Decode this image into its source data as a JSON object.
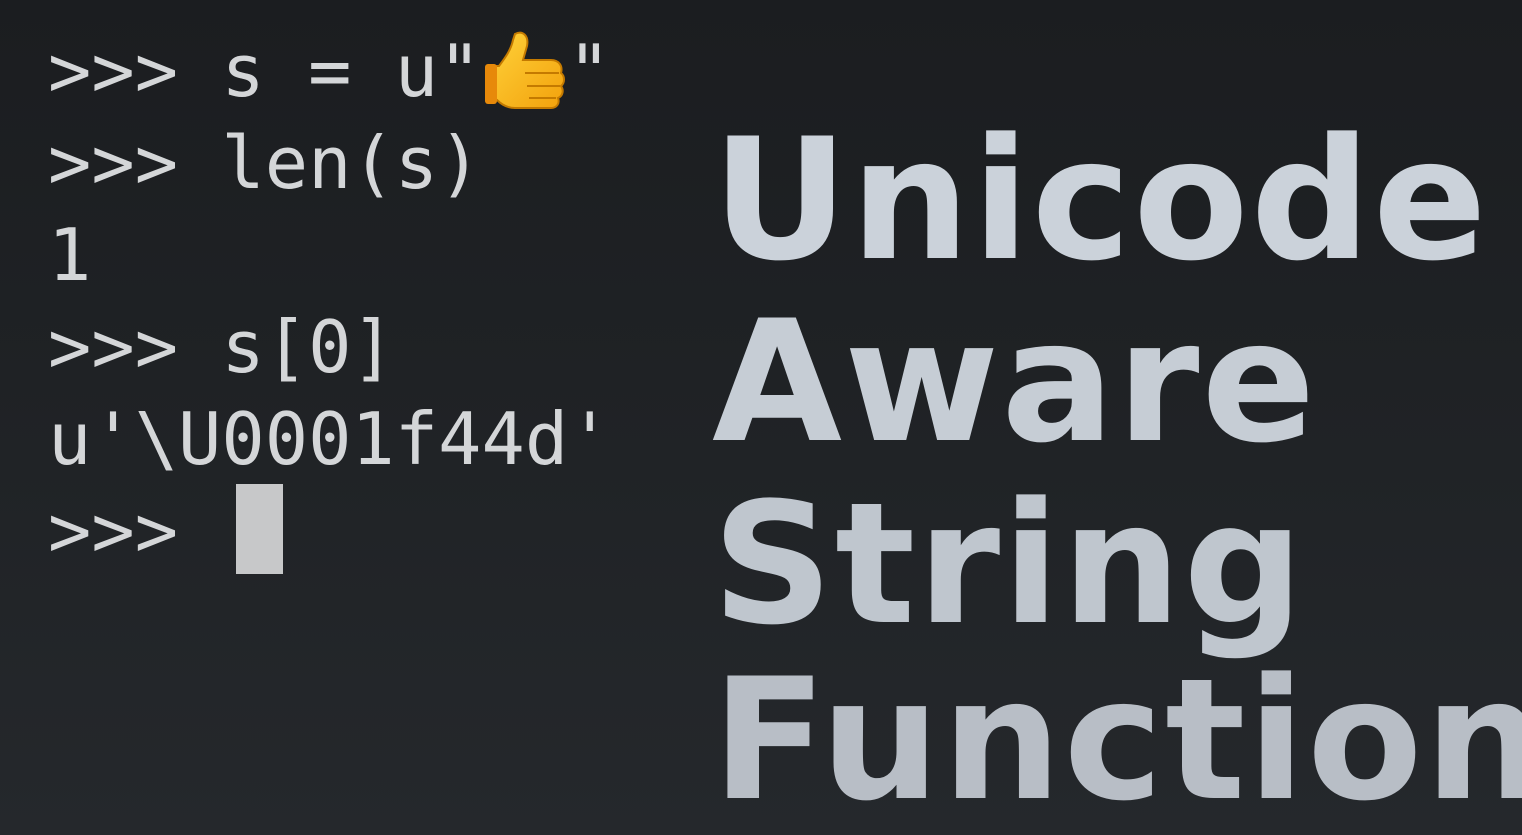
{
  "terminal": {
    "lines": [
      {
        "prompt": ">>> ",
        "code": "s = u\"",
        "emoji": "thumbs-up",
        "suffix": "\""
      },
      {
        "prompt": ">>> ",
        "code": "len(s)"
      },
      {
        "output": "1"
      },
      {
        "prompt": ">>> ",
        "code": "s[0]"
      },
      {
        "output": "u'\\U0001f44d'"
      },
      {
        "prompt": ">>> ",
        "code": ""
      }
    ],
    "text_color": "#d4d6d8",
    "cursor_color": "#c7c8c9"
  },
  "title": {
    "words": [
      "Unicode",
      "Aware",
      "String",
      "Functions"
    ],
    "color": "#c9d0d8"
  },
  "background_color": "#1e2124"
}
